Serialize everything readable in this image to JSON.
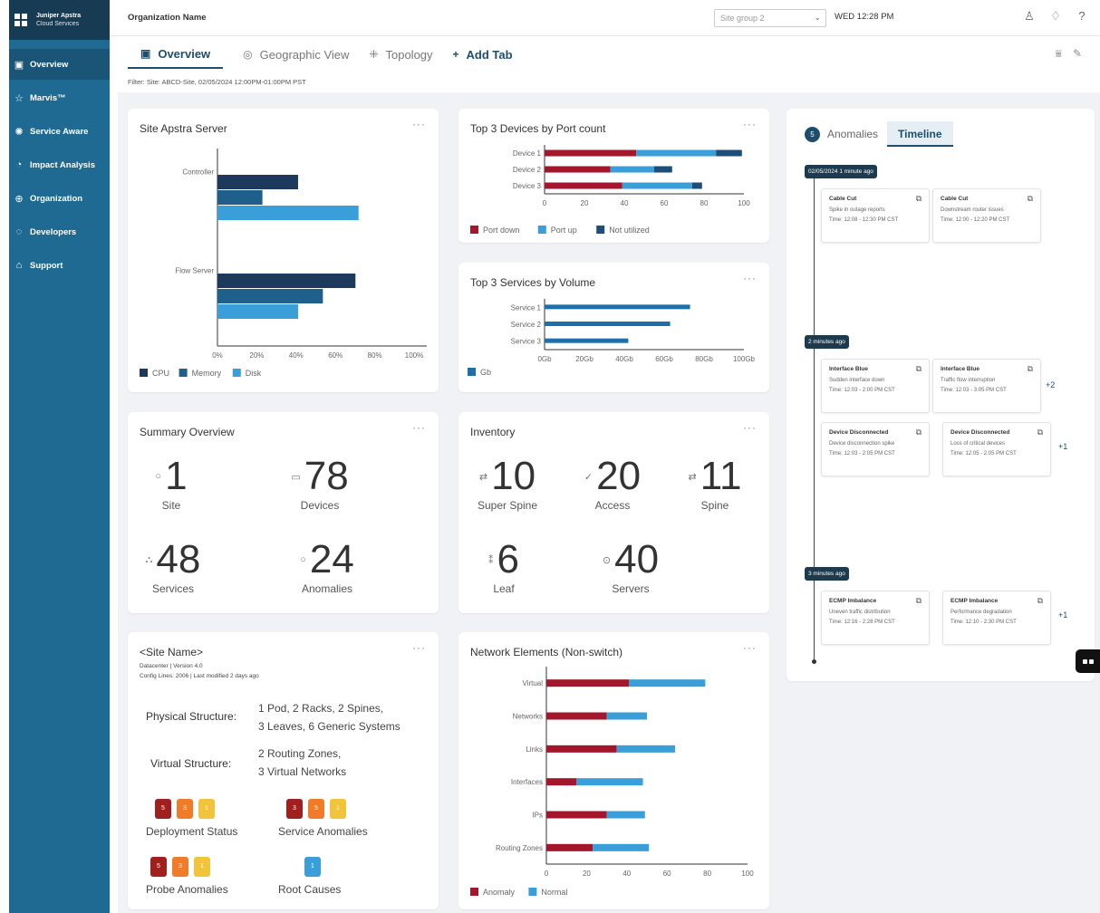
{
  "brand": {
    "line1": "Juniper Apstra",
    "line2": "Cloud Services"
  },
  "sidebar": {
    "items": [
      {
        "label": "Overview",
        "icon": "overview-icon",
        "glyph": "▣",
        "active": true
      },
      {
        "label": "Marvis™",
        "icon": "star-icon",
        "glyph": "☆"
      },
      {
        "label": "Service Aware",
        "icon": "service-icon",
        "glyph": "✺"
      },
      {
        "label": "Impact Analysis",
        "icon": "impact-icon",
        "glyph": "◔"
      },
      {
        "label": "Organization",
        "icon": "globe-icon",
        "glyph": "⊕"
      },
      {
        "label": "Developers",
        "icon": "developers-icon",
        "glyph": "◌"
      },
      {
        "label": "Support",
        "icon": "support-icon",
        "glyph": "⌂"
      }
    ]
  },
  "header": {
    "org_name": "Organization Name",
    "site_group": "Site group 2",
    "clock": "WED 12:28 PM"
  },
  "tabs": [
    {
      "label": "Overview",
      "glyph": "▣"
    },
    {
      "label": "Geographic View",
      "glyph": "◎"
    },
    {
      "label": "Topology",
      "glyph": "⁜"
    },
    {
      "label": "Add Tab",
      "glyph": "+"
    }
  ],
  "filter_text": "Filter: Site: ABCD-Site, 02/05/2024 12:00PM-01:00PM  PST",
  "cards": {
    "apstra": {
      "title": "Site Apstra Server"
    },
    "ports": {
      "title": "Top 3 Devices by Port count"
    },
    "services": {
      "title": "Top 3 Services by Volume"
    },
    "summary": {
      "title": "Summary Overview",
      "stats": [
        {
          "value": "1",
          "label": "Site",
          "glyph": "○"
        },
        {
          "value": "78",
          "label": "Devices",
          "glyph": "▭"
        },
        {
          "value": "48",
          "label": "Services",
          "glyph": "⛬"
        },
        {
          "value": "24",
          "label": "Anomalies",
          "glyph": "○"
        }
      ]
    },
    "inventory": {
      "title": "Inventory",
      "stats": [
        {
          "value": "10",
          "label": "Super Spine",
          "glyph": "⇄"
        },
        {
          "value": "20",
          "label": "Access",
          "glyph": "✓"
        },
        {
          "value": "11",
          "label": "Spine",
          "glyph": "⇄"
        },
        {
          "value": "6",
          "label": "Leaf",
          "glyph": "⁑"
        },
        {
          "value": "40",
          "label": "Servers",
          "glyph": "⊙"
        }
      ]
    },
    "site": {
      "title": "<Site Name>",
      "sub1": "Datacenter | Version 4.0",
      "sub2": "Config Lines: 2006 | Last modified 2 days ago",
      "physical_label": "Physical Structure:",
      "physical_line1": "1 Pod, 2 Racks, 2 Spines,",
      "physical_line2": "3 Leaves, 6 Generic Systems",
      "virtual_label": "Virtual Structure:",
      "virtual_line1": "2 Routing Zones,",
      "virtual_line2": "3 Virtual Networks",
      "groups": [
        {
          "label": "Deployment Status",
          "badges": [
            "5",
            "3",
            "1"
          ]
        },
        {
          "label": "Service Anomalies",
          "badges": [
            "3",
            "5",
            "1"
          ]
        },
        {
          "label": "Probe Anomalies",
          "badges": [
            "5",
            "3",
            "1"
          ]
        },
        {
          "label": "Root Causes",
          "badges": [
            "1"
          ]
        }
      ]
    },
    "network": {
      "title": "Network Elements (Non-switch)"
    }
  },
  "chart_data": [
    {
      "type": "bar",
      "title": "Site Apstra Server",
      "orientation": "horizontal",
      "categories": [
        "Controller",
        "Flow Server"
      ],
      "series": [
        {
          "name": "CPU",
          "values": [
            52,
            89
          ]
        },
        {
          "name": "Memory",
          "values": [
            29,
            68
          ]
        },
        {
          "name": "Disk",
          "values": [
            91,
            52
          ]
        }
      ],
      "xlim": [
        0,
        135
      ],
      "ticks": [
        "0%",
        "20%",
        "40%",
        "60%",
        "80%",
        "100%"
      ],
      "legend": "bottom-left",
      "colors": [
        "#1d3a5c",
        "#1f5f8b",
        "#3a9fd8"
      ]
    },
    {
      "type": "bar",
      "title": "Top 3 Devices by Port count",
      "orientation": "horizontal",
      "stacked": true,
      "categories": [
        "Device 1",
        "Device 2",
        "Device 3"
      ],
      "series": [
        {
          "name": "Port down",
          "values": [
            46,
            33,
            39
          ]
        },
        {
          "name": "Port up",
          "values": [
            40,
            22,
            35
          ]
        },
        {
          "name": "Not utilized",
          "values": [
            13,
            9,
            5
          ]
        }
      ],
      "xlim": [
        0,
        100
      ],
      "ticks": [
        "0",
        "20",
        "40",
        "60",
        "80",
        "100"
      ],
      "legend": "bottom",
      "colors": [
        "#a3162c",
        "#3a9fd8",
        "#1d4e7a"
      ]
    },
    {
      "type": "bar",
      "title": "Top 3 Services by Volume",
      "orientation": "horizontal",
      "categories": [
        "Service 1",
        "Service 2",
        "Service 3"
      ],
      "series": [
        {
          "name": "Gb",
          "values": [
            73,
            63,
            42
          ]
        }
      ],
      "xlim": [
        0,
        100
      ],
      "ticks": [
        "0Gb",
        "20Gb",
        "40Gb",
        "60Gb",
        "80Gb",
        "100Gb"
      ],
      "legend": "bottom-left",
      "colors": [
        "#1f6fa8"
      ]
    },
    {
      "type": "bar",
      "title": "Network Elements (Non-switch)",
      "orientation": "horizontal",
      "stacked": true,
      "categories": [
        "Virtual",
        "Networks",
        "Links",
        "Interfaces",
        "IPs",
        "Routing Zones"
      ],
      "series": [
        {
          "name": "Anomaly",
          "values": [
            41,
            30,
            35,
            15,
            30,
            23
          ]
        },
        {
          "name": "Normal",
          "values": [
            38,
            20,
            29,
            33,
            19,
            28
          ]
        }
      ],
      "xlim": [
        0,
        100
      ],
      "ticks": [
        "0",
        "20",
        "40",
        "60",
        "80",
        "100"
      ],
      "legend": "bottom-left",
      "colors": [
        "#a3162c",
        "#3a9fd8"
      ]
    }
  ],
  "right_panel": {
    "count": "5",
    "tab_anomalies": "Anomalies",
    "tab_timeline": "Timeline",
    "groups": [
      {
        "chip": "02/05/2024 1 minute ago",
        "more": "",
        "events": [
          {
            "title": "Cable Cut",
            "desc": "Spike in outage reports",
            "time": "Time: 12:08 - 12:30 PM CST"
          },
          {
            "title": "Cable Cut",
            "desc": "Downstream router issues",
            "time": "Time: 12:00 - 12:20 PM CST"
          }
        ]
      },
      {
        "chip": "2 minutes ago",
        "more": "+2",
        "events": [
          {
            "title": "Interface Blue",
            "desc": "Sudden interface down",
            "time": "Time: 12:03 - 2:00 PM CST"
          },
          {
            "title": "Interface Blue",
            "desc": "Traffic flow interruption",
            "time": "Time: 12:03 - 3:05 PM CST"
          }
        ]
      },
      {
        "chip": "",
        "more": "+1",
        "events": [
          {
            "title": "Device Disconnected",
            "desc": "Device disconnection spike",
            "time": "Time: 12:03 - 2:05 PM CST"
          },
          {
            "title": "Device Disconnected",
            "desc": "Loss of critical devices",
            "time": "Time: 12:05 - 2:05 PM CST"
          }
        ]
      },
      {
        "chip": "3 minutes ago",
        "more": "+1",
        "events": [
          {
            "title": "ECMP Imbalance",
            "desc": "Uneven traffic distribution",
            "time": "Time: 12:16 - 2:28 PM CST"
          },
          {
            "title": "ECMP Imbalance",
            "desc": "Performance degradation",
            "time": "Time: 12:10 - 2:30 PM CST"
          }
        ]
      }
    ]
  }
}
